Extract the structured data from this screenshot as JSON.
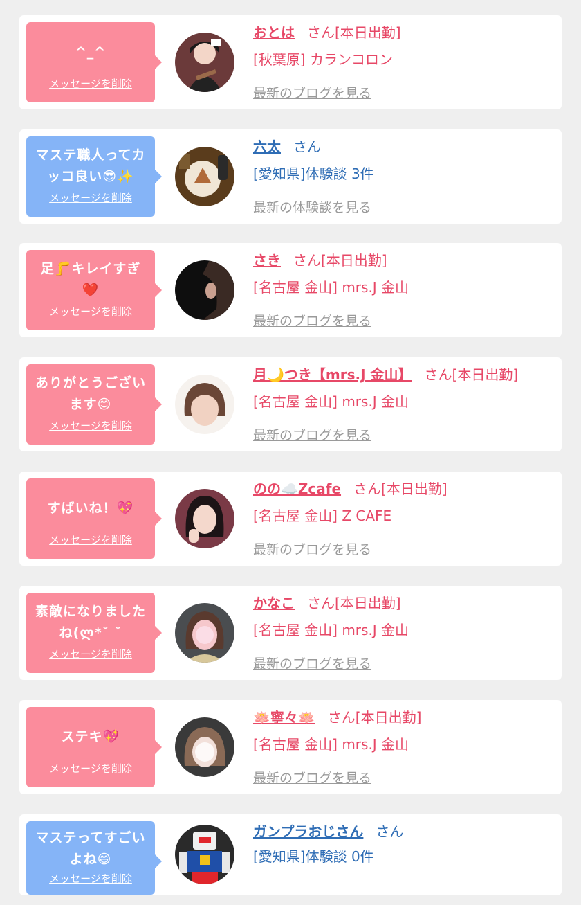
{
  "cards": [
    {
      "bubble": "^_^",
      "delete": "メッセージを削除",
      "name": "おとは",
      "suffix": "さん[本日出勤]",
      "sub": "[秋葉原] カランコロン",
      "link": "最新のブログを見る",
      "theme": "pink"
    },
    {
      "bubble": "マステ職人ってカ\nッコ良い😎✨",
      "delete": "メッセージを削除",
      "name": "六太",
      "suffix": "さん",
      "sub": "[愛知県]体験談 3件",
      "link": "最新の体験談を見る",
      "theme": "blue"
    },
    {
      "bubble": "足🦵キレイすぎ\n❤️",
      "delete": "メッセージを削除",
      "name": "さき",
      "suffix": "さん[本日出勤]",
      "sub": "[名古屋 金山] mrs.J 金山",
      "link": "最新のブログを見る",
      "theme": "pink"
    },
    {
      "bubble": "ありがとうござい\nます😊",
      "delete": "メッセージを削除",
      "name": "月🌙つき【mrs.J 金山】",
      "suffix": "さん[本日出勤]",
      "sub": "[名古屋 金山] mrs.J 金山",
      "link": "最新のブログを見る",
      "theme": "pink"
    },
    {
      "bubble": "すばいね！💖",
      "delete": "メッセージを削除",
      "name": "のの☁️Zcafe",
      "suffix": "さん[本日出勤]",
      "sub": "[名古屋 金山] Z CAFE",
      "link": "最新のブログを見る",
      "theme": "pink"
    },
    {
      "bubble": "素敵になりました\nね(ლ*˘ ˘",
      "delete": "メッセージを削除",
      "name": "かなこ",
      "suffix": "さん[本日出勤]",
      "sub": "[名古屋 金山] mrs.J 金山",
      "link": "最新のブログを見る",
      "theme": "pink"
    },
    {
      "bubble": "ステキ💖",
      "delete": "メッセージを削除",
      "name": "🪷寧々🪷",
      "suffix": "さん[本日出勤]",
      "sub": "[名古屋 金山] mrs.J 金山",
      "link": "最新のブログを見る",
      "theme": "pink"
    },
    {
      "bubble": "マステってすごい\nよね😄",
      "delete": "メッセージを削除",
      "name": "ガンプラおじさん",
      "suffix": "さん",
      "sub": "[愛知県]体験談 0件",
      "link": "",
      "theme": "blue"
    }
  ],
  "colors": {
    "pink_bubble": "#fb8c9c",
    "blue_bubble": "#85b4f7",
    "pink_text": "#e74867",
    "blue_text": "#2f6db5",
    "card_bg": "#ffffff",
    "page_bg": "#efefef"
  },
  "avatars": [
    "cosplay-girl-photo",
    "cake-plate-photo",
    "dark-hair-closeup-photo",
    "woman-portrait-photo",
    "girl-peace-sign-photo",
    "blurred-face-photo",
    "blurred-face-photo-2",
    "gundam-model-photo"
  ]
}
